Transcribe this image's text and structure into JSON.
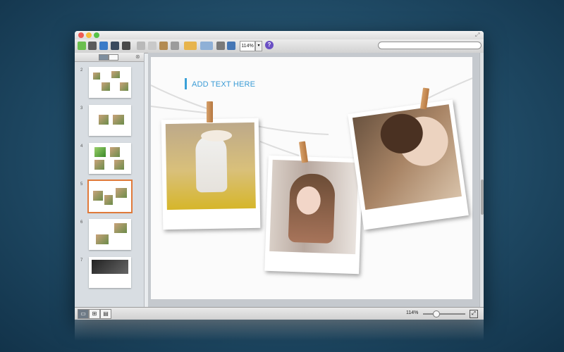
{
  "toolbar": {
    "zoom_value": "114%",
    "help_label": "?",
    "search_placeholder": ""
  },
  "sidebar": {
    "slides": [
      {
        "number": "2"
      },
      {
        "number": "3"
      },
      {
        "number": "4"
      },
      {
        "number": "5",
        "selected": true
      },
      {
        "number": "6"
      },
      {
        "number": "7"
      }
    ]
  },
  "slide": {
    "title": "ADD TEXT HERE"
  },
  "statusbar": {
    "zoom": "114%",
    "zoom_fraction": 0.3
  },
  "colors": {
    "accent": "#3a9bd6",
    "selection": "#e07a3a",
    "pin": "#c78a4f"
  }
}
